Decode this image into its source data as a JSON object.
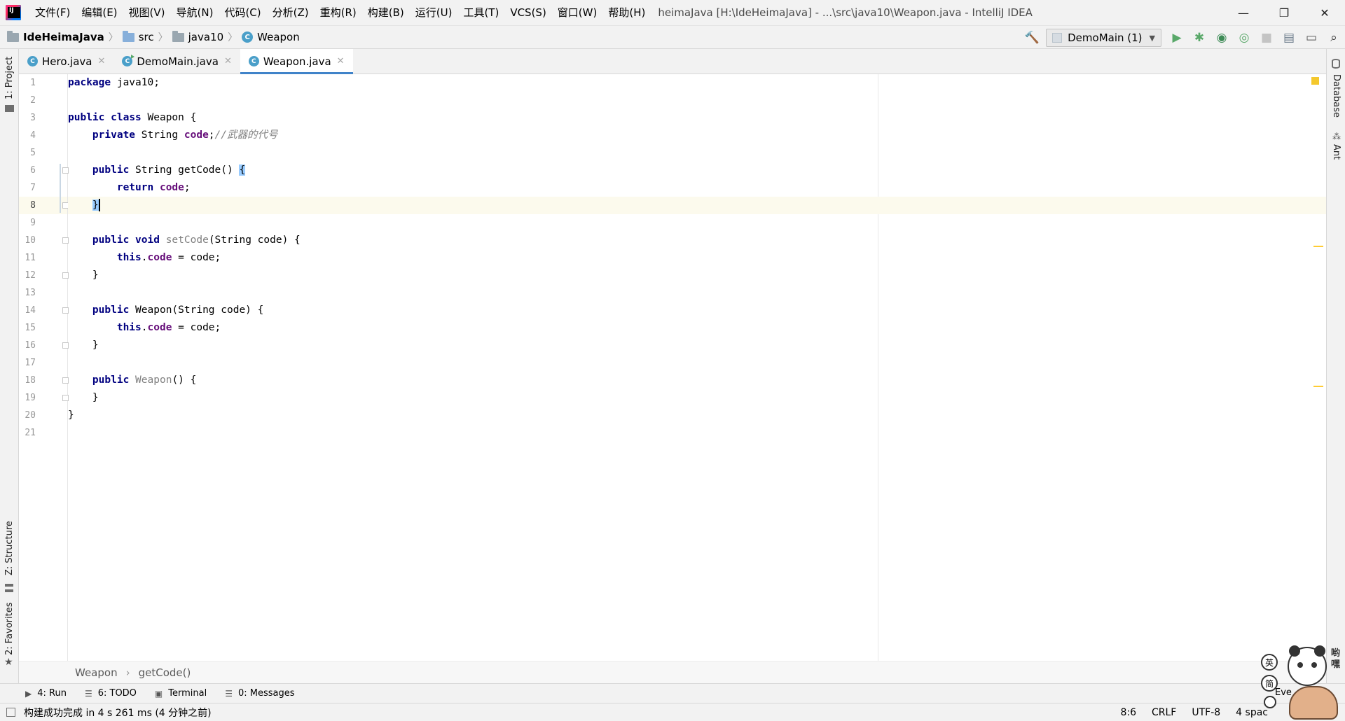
{
  "window": {
    "title": "heimaJava [H:\\IdeHeimaJava] - ...\\src\\java10\\Weapon.java - IntelliJ IDEA",
    "controls": [
      "—",
      "❐",
      "✕"
    ]
  },
  "menu": [
    "文件(F)",
    "编辑(E)",
    "视图(V)",
    "导航(N)",
    "代码(C)",
    "分析(Z)",
    "重构(R)",
    "构建(B)",
    "运行(U)",
    "工具(T)",
    "VCS(S)",
    "窗口(W)",
    "帮助(H)"
  ],
  "breadcrumb": {
    "project": "IdeHeimaJava",
    "src": "src",
    "package": "java10",
    "class": "Weapon"
  },
  "toolbar": {
    "run_config": "DemoMain (1)",
    "colors": {
      "run": "#59a869",
      "debug": "#59a869",
      "build": "#59a869"
    }
  },
  "side": {
    "project": "1: Project",
    "structure": "Z: Structure",
    "favorites": "2: Favorites",
    "database": "Database",
    "ant": "Ant"
  },
  "tabs": [
    {
      "label": "Hero.java",
      "active": false
    },
    {
      "label": "DemoMain.java",
      "active": false
    },
    {
      "label": "Weapon.java",
      "active": true
    }
  ],
  "code": {
    "line_numbers": [
      "1",
      "2",
      "3",
      "4",
      "5",
      "6",
      "7",
      "8",
      "9",
      "10",
      "11",
      "12",
      "13",
      "14",
      "15",
      "16",
      "17",
      "18",
      "19",
      "20",
      "21"
    ],
    "current_line": 8,
    "l1": [
      "package",
      " java10;"
    ],
    "l3": [
      "public",
      " ",
      "class",
      " Weapon {"
    ],
    "l4": [
      "    ",
      "private",
      " String ",
      "code",
      ";",
      "//武器的代号"
    ],
    "l6": [
      "    ",
      "public",
      " String getCode() ",
      "{"
    ],
    "l7": [
      "        ",
      "return",
      " ",
      "code",
      ";"
    ],
    "l8": [
      "    ",
      "}"
    ],
    "l10": [
      "    ",
      "public",
      " ",
      "void",
      " ",
      "setCode",
      "(String code) {"
    ],
    "l11": [
      "        ",
      "this",
      ".",
      "code",
      " = code;"
    ],
    "l12": [
      "    }"
    ],
    "l14": [
      "    ",
      "public",
      " Weapon(String code) {"
    ],
    "l15": [
      "        ",
      "this",
      ".",
      "code",
      " = code;"
    ],
    "l16": [
      "    }"
    ],
    "l18": [
      "    ",
      "public",
      " ",
      "Weapon",
      "() {"
    ],
    "l19": [
      "    }"
    ],
    "l20": [
      "}"
    ]
  },
  "code_breadcrumbs": {
    "class": "Weapon",
    "method": "getCode()"
  },
  "toolwindows": [
    {
      "label": "4: Run",
      "icon": "▶"
    },
    {
      "label": "6: TODO",
      "icon": "☰"
    },
    {
      "label": "Terminal",
      "icon": "▣"
    },
    {
      "label": "0: Messages",
      "icon": "☰"
    }
  ],
  "status": {
    "message": "构建成功完成 in 4 s 261 ms (4 分钟之前)",
    "position": "8:6",
    "line_sep": "CRLF",
    "encoding": "UTF-8",
    "indent": "4 spac",
    "event_log": "Eve"
  },
  "overlay": {
    "ime_en": "英",
    "ime_simplified": "简",
    "mascot_text": "哟嘿"
  }
}
